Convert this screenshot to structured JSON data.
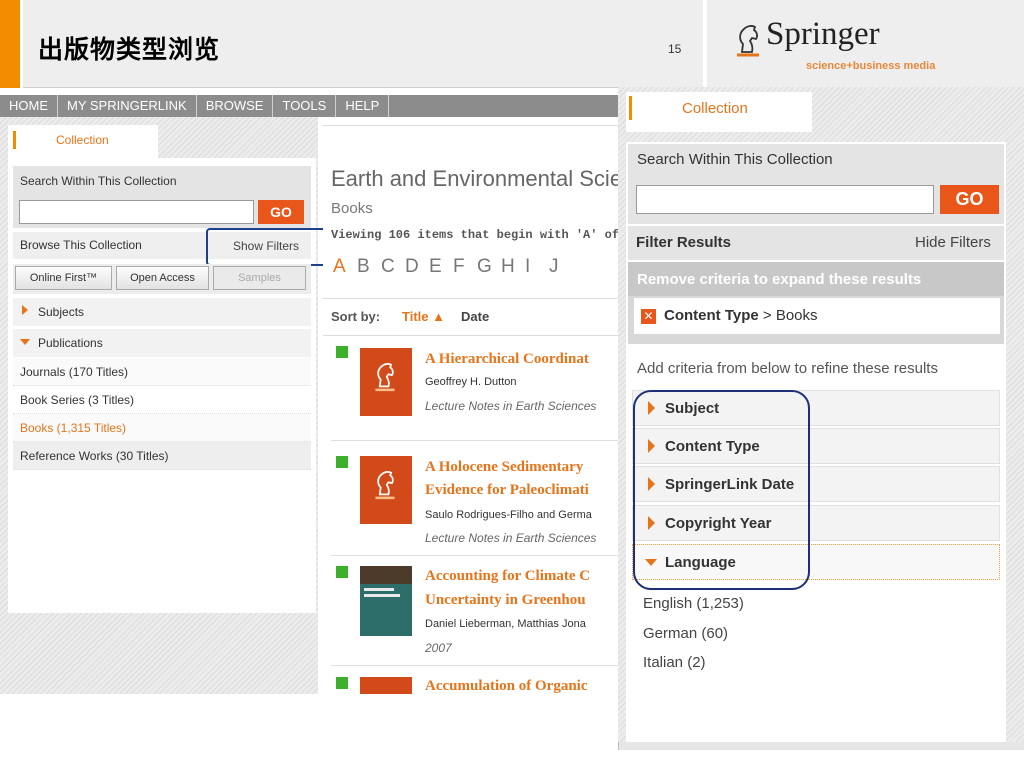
{
  "slide": {
    "title": "出版物类型浏览",
    "page_number": "15",
    "logo": {
      "wordmark": "Springer",
      "tagline": "science+business media"
    }
  },
  "nav": {
    "items": [
      "HOME",
      "MY SPRINGERLINK",
      "BROWSE",
      "TOOLS",
      "HELP"
    ]
  },
  "left_panel": {
    "tab_label": "Collection",
    "search_label": "Search Within This Collection",
    "go_label": "GO",
    "browse_label": "Browse This Collection",
    "show_filters": "Show Filters",
    "buttons": [
      "Online First™",
      "Open Access",
      "Samples"
    ],
    "subjects_label": "Subjects",
    "publications_label": "Publications",
    "publications": [
      "Journals (170 Titles)",
      "Book Series (3 Titles)",
      "Books (1,315 Titles)",
      "Reference Works (30 Titles)"
    ]
  },
  "main": {
    "collection_title": "Earth and Environmental Scie",
    "collection_subtitle": "Books",
    "viewing_text": "Viewing 106 items that begin with 'A' of",
    "letters": [
      "A",
      "B",
      "C",
      "D",
      "E",
      "F",
      "G",
      "H",
      "I",
      "J"
    ],
    "sort_label": "Sort by:",
    "sort_title": "Title ▲",
    "sort_date": "Date",
    "results": [
      {
        "title_lines": [
          "A Hierarchical Coordinat"
        ],
        "author": "Geoffrey H. Dutton",
        "series": "Lecture Notes in Earth Sciences"
      },
      {
        "title_lines": [
          "A Holocene Sedimentary",
          "Evidence for Paleoclimati"
        ],
        "author": "Saulo Rodrigues-Filho and Germa",
        "series": "Lecture Notes in Earth Sciences"
      },
      {
        "title_lines": [
          "Accounting for Climate C",
          "Uncertainty in Greenhou"
        ],
        "author": "Daniel Lieberman, Matthias Jona",
        "series": "2007"
      },
      {
        "title_lines": [
          "Accumulation of Organic"
        ],
        "author": "",
        "series": ""
      }
    ]
  },
  "right_panel": {
    "tab_label": "Collection",
    "search_label": "Search Within This Collection",
    "go_label": "GO",
    "filter_results": "Filter Results",
    "hide_filters": "Hide Filters",
    "remove_criteria": "Remove criteria to expand these results",
    "criterion": {
      "key": "Content Type",
      "value": "> Books"
    },
    "add_criteria": "Add criteria from below to refine these results",
    "facets": [
      "Subject",
      "Content Type",
      "SpringerLink Date",
      "Copyright Year",
      "Language"
    ],
    "languages": [
      "English (1,253)",
      "German (60)",
      "Italian (2)"
    ]
  },
  "colors": {
    "accent_orange": "#f28c00",
    "go_button": "#e8561a",
    "highlight_blue": "#1e3f8a",
    "green_marker": "#3cb02a"
  }
}
